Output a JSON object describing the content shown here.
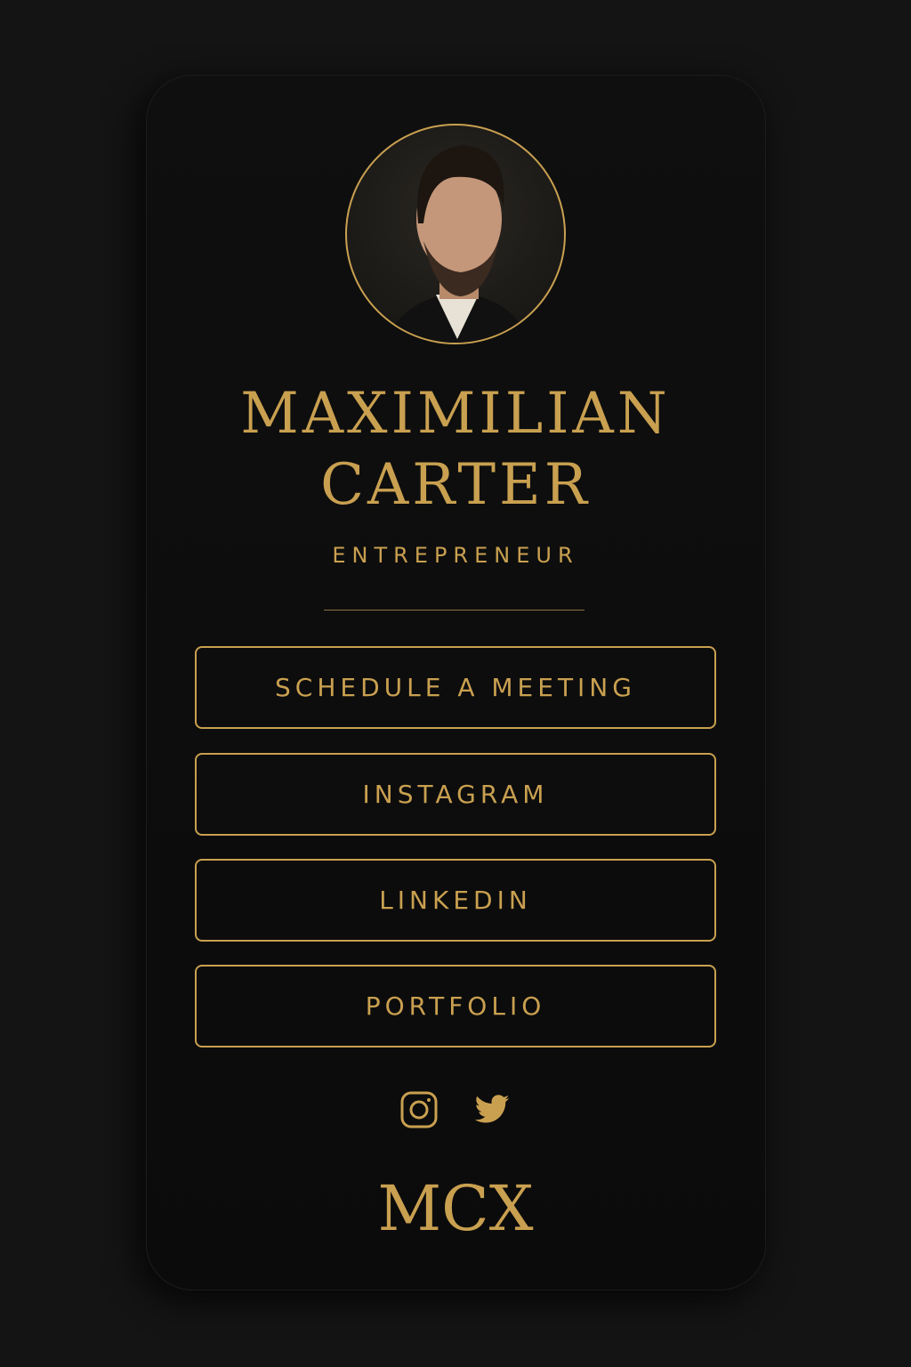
{
  "profile": {
    "name_line1": "MAXIMILIAN",
    "name_line2": "CARTER",
    "role": "ENTREPRENEUR"
  },
  "buttons": [
    {
      "label": "SCHEDULE A MEETING"
    },
    {
      "label": "INSTAGRAM"
    },
    {
      "label": "LINKEDIN"
    },
    {
      "label": "PORTFOLIO"
    }
  ],
  "social_icons": [
    "instagram-icon",
    "twitter-icon"
  ],
  "logo": "MCX",
  "colors": {
    "accent": "#c9a050",
    "background": "#0d0d0d"
  }
}
